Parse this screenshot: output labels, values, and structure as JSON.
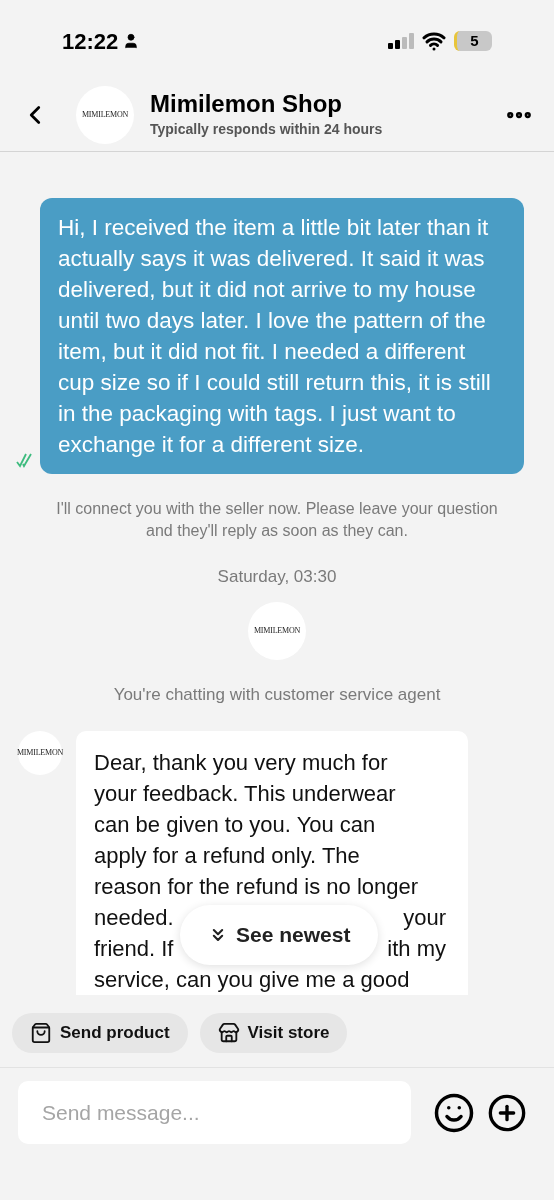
{
  "status_bar": {
    "time": "12:22",
    "battery": "5"
  },
  "header": {
    "logo": "MIMILEMON",
    "title": "Mimilemon Shop",
    "subtitle": "Typically responds within 24 hours"
  },
  "user_message": {
    "text": "Hi, I received the item a little bit later than it actually says it was delivered. It said it was delivered, but it did not arrive to my house until two days later. I love the pattern of the item, but it did not fit. I needed a different cup size so if I could still return this, it is still in the packaging with tags. I just want to exchange it for a different size.",
    "read": true
  },
  "system_note": "I'll connect you with the seller now. Please leave your question and they'll reply as soon as they can.",
  "timestamp": "Saturday, 03:30",
  "center_logo": "MIMILEMON",
  "agent_note": "You're chatting with customer service agent",
  "agent_message": {
    "avatar": "MIMILEMON",
    "lines": [
      {
        "left": "Dear, thank you very much for"
      },
      {
        "left": "your feedback. This underwear"
      },
      {
        "left": "can be given to you. You can"
      },
      {
        "left": "apply for a refund only. The"
      },
      {
        "left": "reason for the refund is no longer"
      },
      {
        "left": "needed.",
        "right": "your"
      },
      {
        "left": "friend. If",
        "right": "ith my"
      },
      {
        "left": "service, can you give me a good"
      }
    ]
  },
  "see_newest": "See newest",
  "actions": [
    {
      "kind": "product",
      "label": "Send product"
    },
    {
      "kind": "store",
      "label": "Visit store"
    }
  ],
  "composer": {
    "placeholder": "Send message..."
  }
}
